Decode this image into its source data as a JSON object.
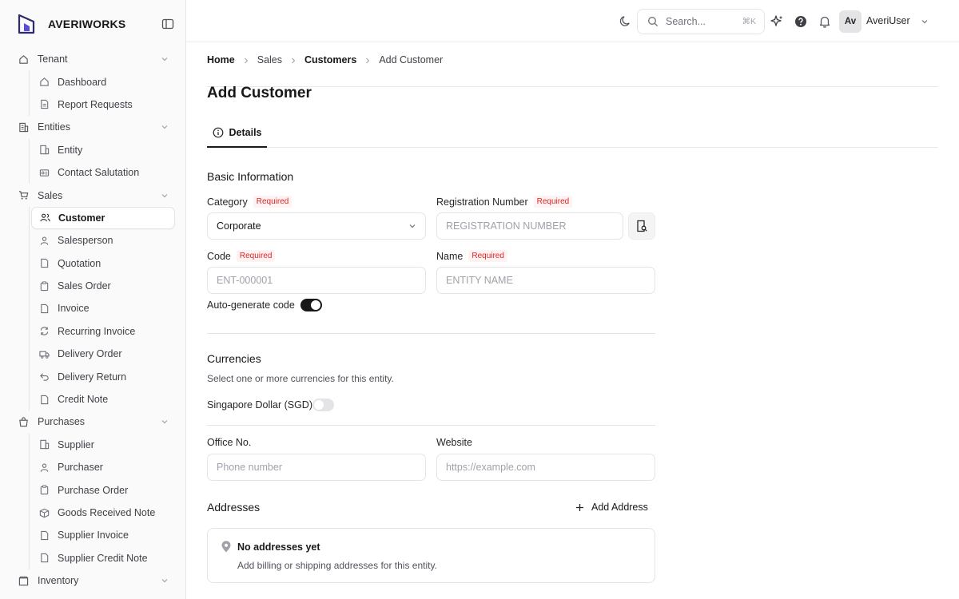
{
  "brand": {
    "name": "AVERIWORKS"
  },
  "sidebar": {
    "groups": [
      {
        "label": "Tenant",
        "items": [
          {
            "label": "Dashboard"
          },
          {
            "label": "Report Requests"
          }
        ]
      },
      {
        "label": "Entities",
        "items": [
          {
            "label": "Entity"
          },
          {
            "label": "Contact Salutation"
          }
        ]
      },
      {
        "label": "Sales",
        "items": [
          {
            "label": "Customer"
          },
          {
            "label": "Salesperson"
          },
          {
            "label": "Quotation"
          },
          {
            "label": "Sales Order"
          },
          {
            "label": "Invoice"
          },
          {
            "label": "Recurring Invoice"
          },
          {
            "label": "Delivery Order"
          },
          {
            "label": "Delivery Return"
          },
          {
            "label": "Credit Note"
          }
        ]
      },
      {
        "label": "Purchases",
        "items": [
          {
            "label": "Supplier"
          },
          {
            "label": "Purchaser"
          },
          {
            "label": "Purchase Order"
          },
          {
            "label": "Goods Received Note"
          },
          {
            "label": "Supplier Invoice"
          },
          {
            "label": "Supplier Credit Note"
          }
        ]
      },
      {
        "label": "Inventory",
        "items": []
      }
    ],
    "active_item": "Customer"
  },
  "header": {
    "search_placeholder": "Search...",
    "search_shortcut": "⌘K",
    "avatar_initials": "Av",
    "user_name": "AveriUser"
  },
  "breadcrumb": [
    "Home",
    "Sales",
    "Customers",
    "Add Customer"
  ],
  "page": {
    "title": "Add Customer",
    "tab": "Details"
  },
  "basic": {
    "title": "Basic Information",
    "required_badge": "Required",
    "category_label": "Category",
    "category_value": "Corporate",
    "reg_label": "Registration Number",
    "reg_placeholder": "REGISTRATION NUMBER",
    "code_label": "Code",
    "code_placeholder": "ENT-000001",
    "name_label": "Name",
    "name_placeholder": "ENTITY NAME",
    "auto_label": "Auto-generate code",
    "auto_on": true
  },
  "currencies": {
    "title": "Currencies",
    "desc": "Select one or more currencies for this entity.",
    "sgd_label": "Singapore Dollar (SGD)",
    "sgd_on": false
  },
  "contact": {
    "office_label": "Office No.",
    "office_placeholder": "Phone number",
    "website_label": "Website",
    "website_placeholder": "https://example.com"
  },
  "addresses": {
    "title": "Addresses",
    "add_label": "Add Address",
    "empty_title": "No addresses yet",
    "empty_desc": "Add billing or shipping addresses for this entity."
  },
  "colors": {
    "accent": "#18181b",
    "required": "#dc2626",
    "required_bg": "#fef2f2",
    "border": "#e4e4e7"
  }
}
